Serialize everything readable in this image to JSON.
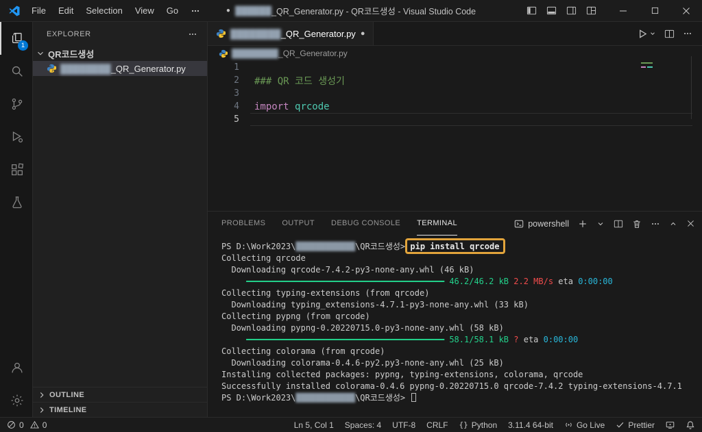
{
  "colors": {
    "accent_badge": "#0078d4",
    "annotation_box": "#e2a43b",
    "code_comment": "#6a9955",
    "code_keyword": "#c586c0",
    "code_module": "#4ec9b0",
    "terminal_green": "#23d18b",
    "terminal_red": "#f14c4c",
    "terminal_cyan": "#29b8db"
  },
  "titlebar": {
    "menus": [
      "File",
      "Edit",
      "Selection",
      "View",
      "Go"
    ],
    "dirty_dot": "●",
    "redacted": "██████",
    "title": "_QR_Generator.py - QR코드생성 - Visual Studio Code"
  },
  "activity": {
    "badge": "1"
  },
  "sidebar": {
    "header": "EXPLORER",
    "root_folder": "QR코드생성",
    "file_redacted": "████████",
    "file_name": "_QR_Generator.py",
    "outline_label": "OUTLINE",
    "timeline_label": "TIMELINE"
  },
  "editor": {
    "tab": {
      "redacted": "████████",
      "name": "_QR_Generator.py",
      "dirty_dot": "●"
    },
    "breadcrumb": {
      "redacted": "████████",
      "name": "_QR_Generator.py"
    },
    "line_numbers": [
      "1",
      "2",
      "3",
      "4",
      "5"
    ],
    "code": {
      "comment": "### QR 코드 생성기",
      "keyword": "import",
      "space": " ",
      "module": "qrcode"
    }
  },
  "panel": {
    "tabs": [
      "PROBLEMS",
      "OUTPUT",
      "DEBUG CONSOLE",
      "TERMINAL"
    ],
    "shell": "powershell"
  },
  "terminal": {
    "lines": [
      {
        "segments": [
          {
            "t": "PS D:\\Work2023\\"
          },
          {
            "t": "████████████",
            "c": "redact"
          },
          {
            "t": "\\QR코드생성> "
          },
          {
            "t": "pip install qrcode",
            "box": true
          }
        ]
      },
      {
        "segments": [
          {
            "t": "Collecting qrcode"
          }
        ]
      },
      {
        "segments": [
          {
            "t": "  Downloading qrcode-7.4.2-py3-none-any.whl (46 kB)"
          }
        ]
      },
      {
        "segments": [
          {
            "t": "     "
          },
          {
            "t": "━━━━━━━━━━━━━━━━━━━━━━━━━━━━━━━━━━━━━━━━ 46.2/46.2 kB",
            "c": "green"
          },
          {
            "t": " "
          },
          {
            "t": "2.2 MB/s",
            "c": "red"
          },
          {
            "t": " eta "
          },
          {
            "t": "0:00:00",
            "c": "cyan"
          }
        ]
      },
      {
        "segments": [
          {
            "t": "Collecting typing-extensions (from qrcode)"
          }
        ]
      },
      {
        "segments": [
          {
            "t": "  Downloading typing_extensions-4.7.1-py3-none-any.whl (33 kB)"
          }
        ]
      },
      {
        "segments": [
          {
            "t": "Collecting pypng (from qrcode)"
          }
        ]
      },
      {
        "segments": [
          {
            "t": "  Downloading pypng-0.20220715.0-py3-none-any.whl (58 kB)"
          }
        ]
      },
      {
        "segments": [
          {
            "t": "     "
          },
          {
            "t": "━━━━━━━━━━━━━━━━━━━━━━━━━━━━━━━━━━━━━━━━ 58.1/58.1 kB",
            "c": "green"
          },
          {
            "t": " "
          },
          {
            "t": "?",
            "c": "red"
          },
          {
            "t": " eta "
          },
          {
            "t": "0:00:00",
            "c": "cyan"
          }
        ]
      },
      {
        "segments": [
          {
            "t": "Collecting colorama (from qrcode)"
          }
        ]
      },
      {
        "segments": [
          {
            "t": "  Downloading colorama-0.4.6-py2.py3-none-any.whl (25 kB)"
          }
        ]
      },
      {
        "segments": [
          {
            "t": "Installing collected packages: pypng, typing-extensions, colorama, qrcode"
          }
        ]
      },
      {
        "segments": [
          {
            "t": "Successfully installed colorama-0.4.6 pypng-0.20220715.0 qrcode-7.4.2 typing-extensions-4.7.1"
          }
        ]
      },
      {
        "cursor": true,
        "segments": [
          {
            "t": "PS D:\\Work2023\\"
          },
          {
            "t": "████████████",
            "c": "redact"
          },
          {
            "t": "\\QR코드생성> "
          }
        ]
      }
    ]
  },
  "statusbar": {
    "errors": "0",
    "warnings": "0",
    "cursor_position": "Ln 5, Col 1",
    "indentation": "Spaces: 4",
    "encoding": "UTF-8",
    "eol": "CRLF",
    "language_icon": "{}",
    "language": "Python",
    "interpreter": "3.11.4 64-bit",
    "go_live": "Go Live",
    "prettier": "Prettier"
  }
}
